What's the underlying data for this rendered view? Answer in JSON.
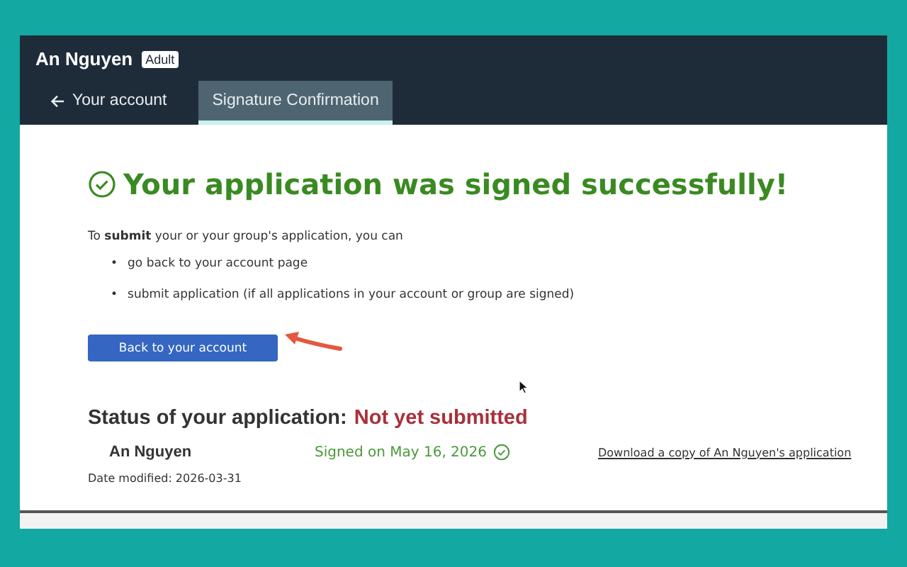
{
  "header": {
    "user_name": "An Nguyen",
    "badge": "Adult"
  },
  "tabs": [
    {
      "label": "Your account",
      "kind": "back",
      "selected": false
    },
    {
      "label": "Signature Confirmation",
      "kind": "plain",
      "selected": true
    }
  ],
  "heading": "Your application was signed successfully!",
  "intro": "To **submit** your or your group's application, you can",
  "bullets": [
    {
      "marker": "•",
      "text": "go back to your account page"
    },
    {
      "marker": "•",
      "text": "submit application (if all applications in your account or group are signed)"
    }
  ],
  "button": "Back to your account",
  "status": {
    "label": "Status of your application:",
    "value": "Not yet submitted"
  },
  "applicants": [
    {
      "name": "An Nguyen",
      "signed": "Signed on May 16, 2026",
      "link": "Download a copy of An Nguyen's application"
    }
  ],
  "date_modified": "Date modified: 2026-03-31"
}
